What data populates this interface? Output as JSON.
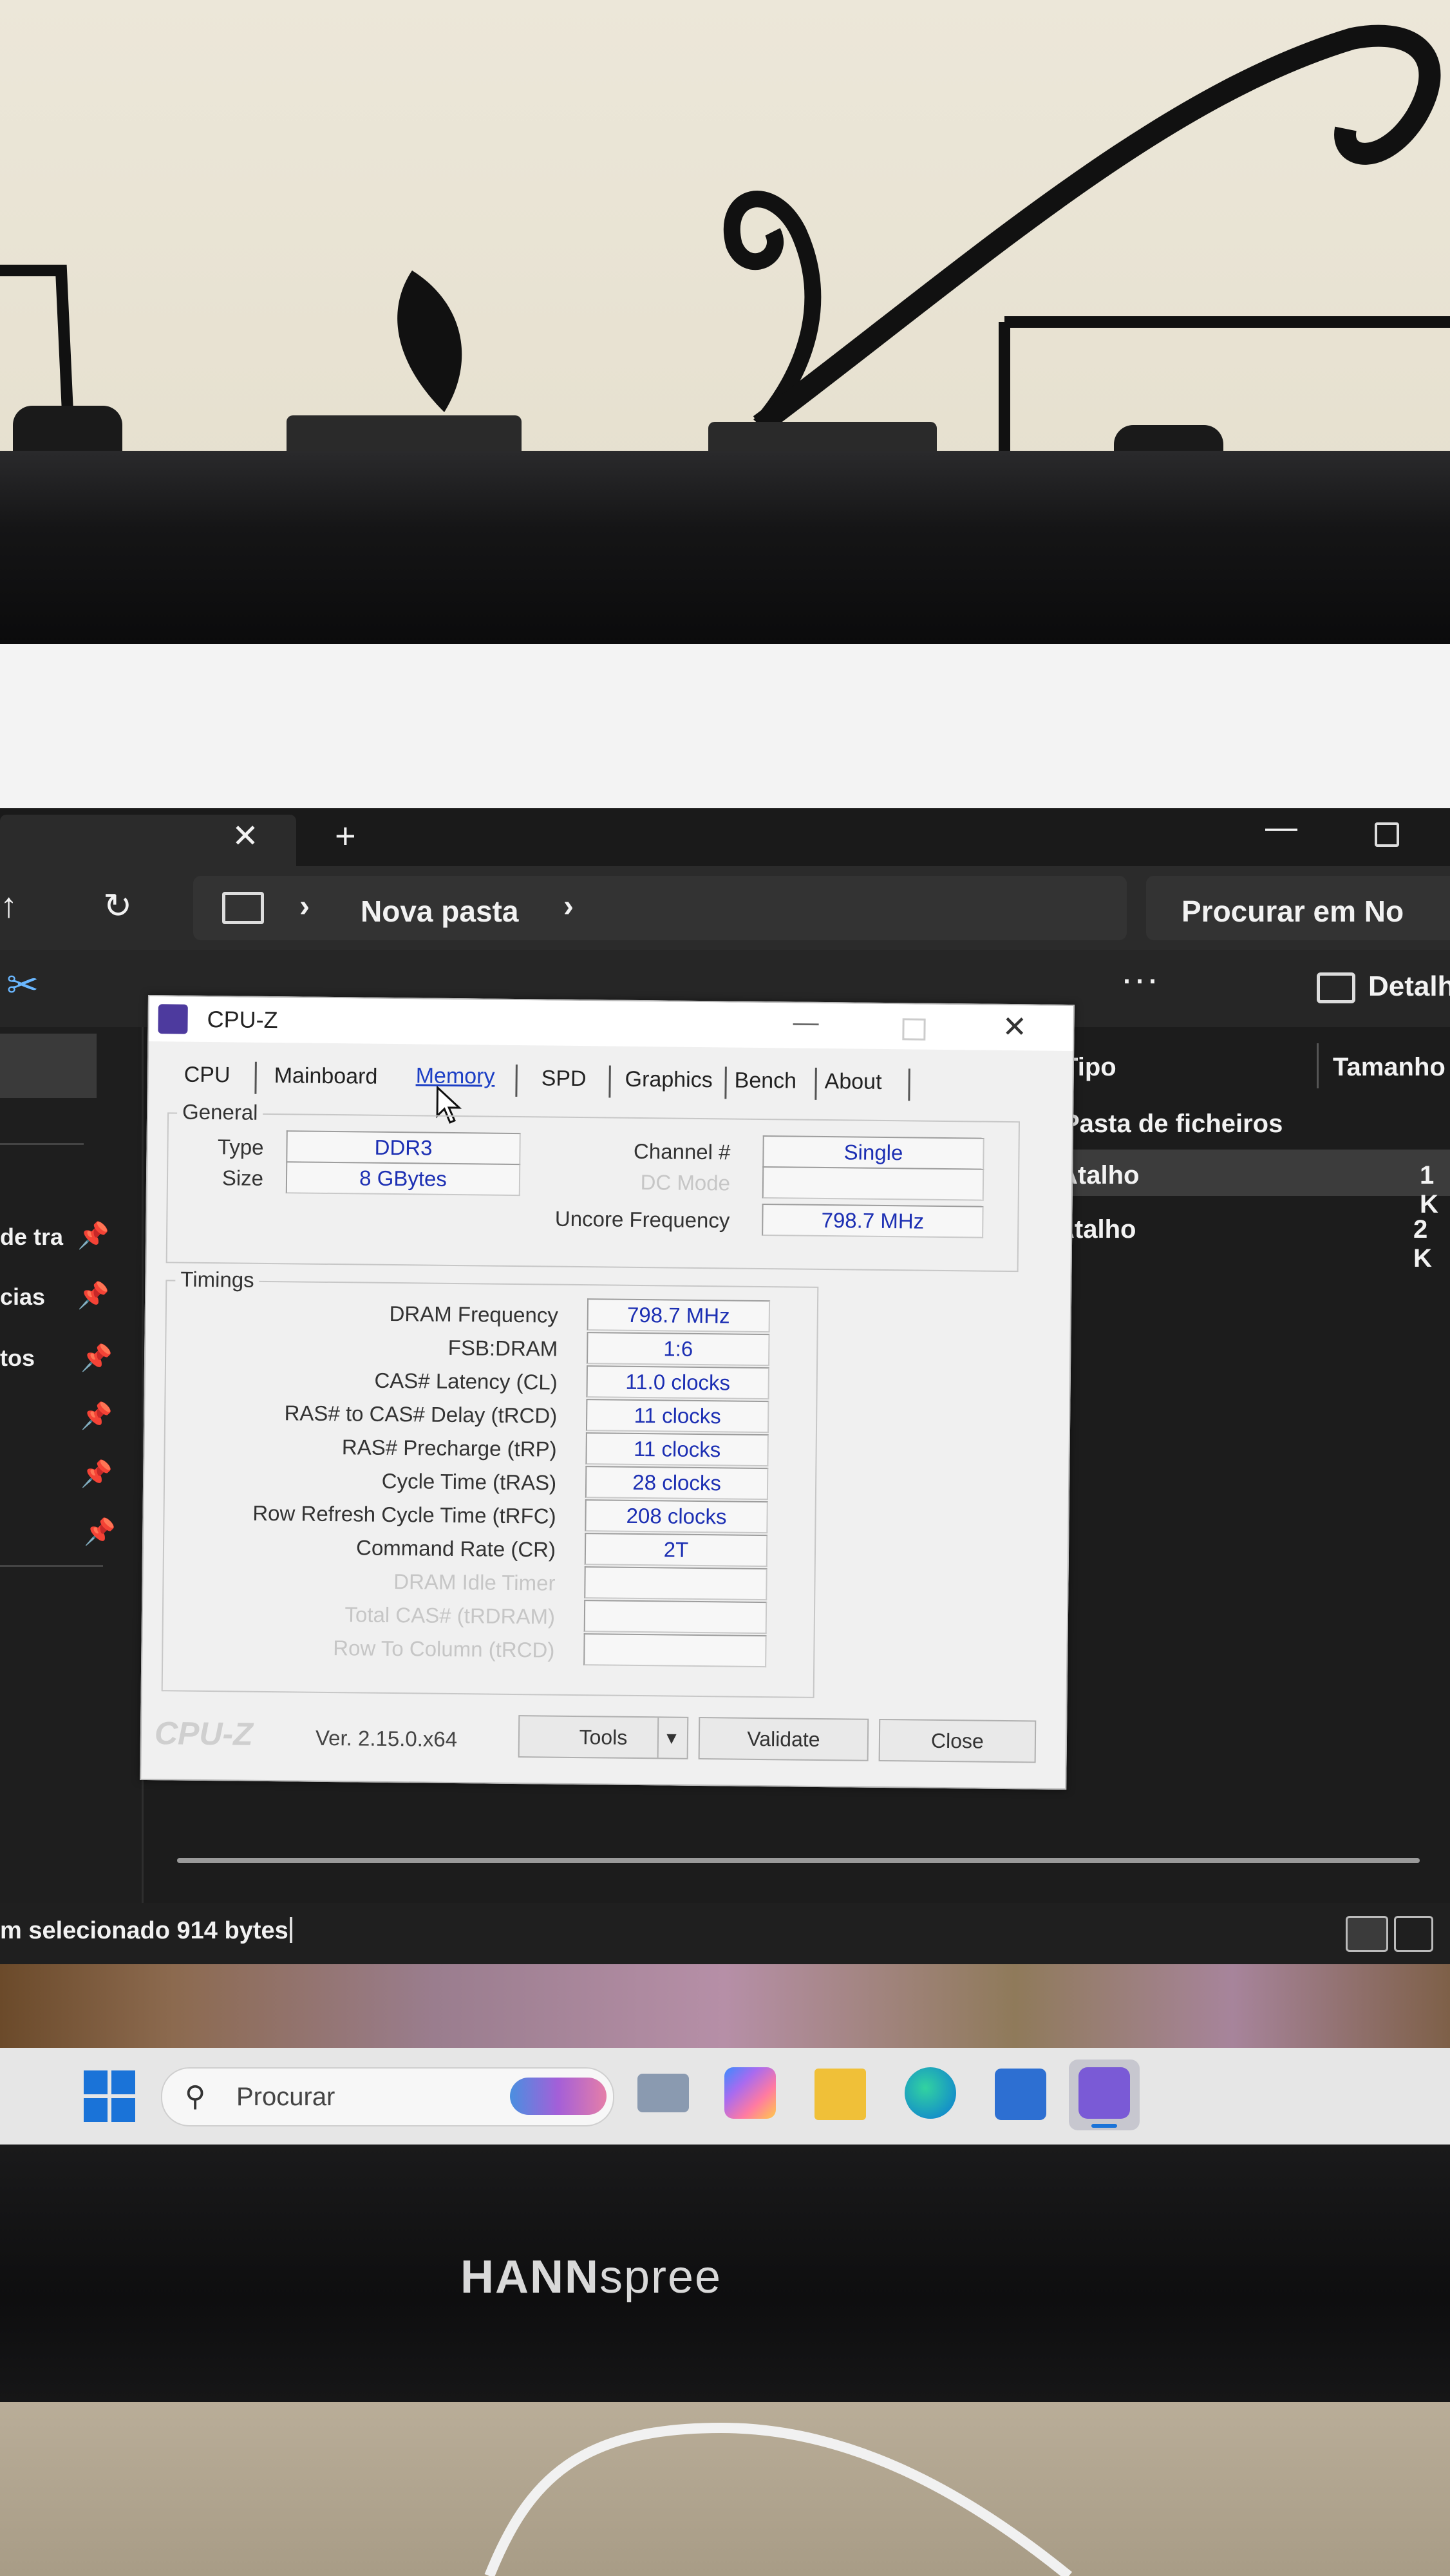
{
  "explorer": {
    "breadcrumb_folder": "Nova pasta",
    "search_placeholder": "Procurar em No",
    "toolbar_details": "Detalh",
    "columns": [
      "Tipo",
      "Tamanho"
    ],
    "rows": [
      {
        "type": "Pasta de ficheiros",
        "size": ""
      },
      {
        "type": "Atalho",
        "size": "1 K"
      },
      {
        "type": "Atalho",
        "size": "2 K"
      }
    ],
    "sidebar_items": [
      "de tra",
      "cias",
      "tos"
    ],
    "status_text": "m selecionado 914 bytes"
  },
  "taskbar": {
    "search_placeholder": "Procurar"
  },
  "monitor": {
    "brand_bold": "HANN",
    "brand_light": "spree"
  },
  "cpuz": {
    "title": "CPU-Z",
    "tabs": [
      "CPU",
      "Mainboard",
      "Memory",
      "SPD",
      "Graphics",
      "Bench",
      "About"
    ],
    "active_tab": "Memory",
    "general": {
      "legend": "General",
      "type_label": "Type",
      "type_value": "DDR3",
      "size_label": "Size",
      "size_value": "8 GBytes",
      "channel_label": "Channel #",
      "channel_value": "Single",
      "dc_mode_label": "DC Mode",
      "uncore_label": "Uncore Frequency",
      "uncore_value": "798.7 MHz"
    },
    "timings": {
      "legend": "Timings",
      "rows": [
        {
          "label": "DRAM Frequency",
          "value": "798.7 MHz"
        },
        {
          "label": "FSB:DRAM",
          "value": "1:6"
        },
        {
          "label": "CAS# Latency (CL)",
          "value": "11.0 clocks"
        },
        {
          "label": "RAS# to CAS# Delay (tRCD)",
          "value": "11 clocks"
        },
        {
          "label": "RAS# Precharge (tRP)",
          "value": "11 clocks"
        },
        {
          "label": "Cycle Time (tRAS)",
          "value": "28 clocks"
        },
        {
          "label": "Row Refresh Cycle Time (tRFC)",
          "value": "208 clocks"
        },
        {
          "label": "Command Rate (CR)",
          "value": "2T"
        },
        {
          "label": "DRAM Idle Timer",
          "value": ""
        },
        {
          "label": "Total CAS# (tRDRAM)",
          "value": ""
        },
        {
          "label": "Row To Column (tRCD)",
          "value": ""
        }
      ]
    },
    "footer": {
      "logo": "CPU-Z",
      "version": "Ver. 2.15.0.x64",
      "tools_label": "Tools",
      "validate_label": "Validate",
      "close_label": "Close"
    }
  }
}
